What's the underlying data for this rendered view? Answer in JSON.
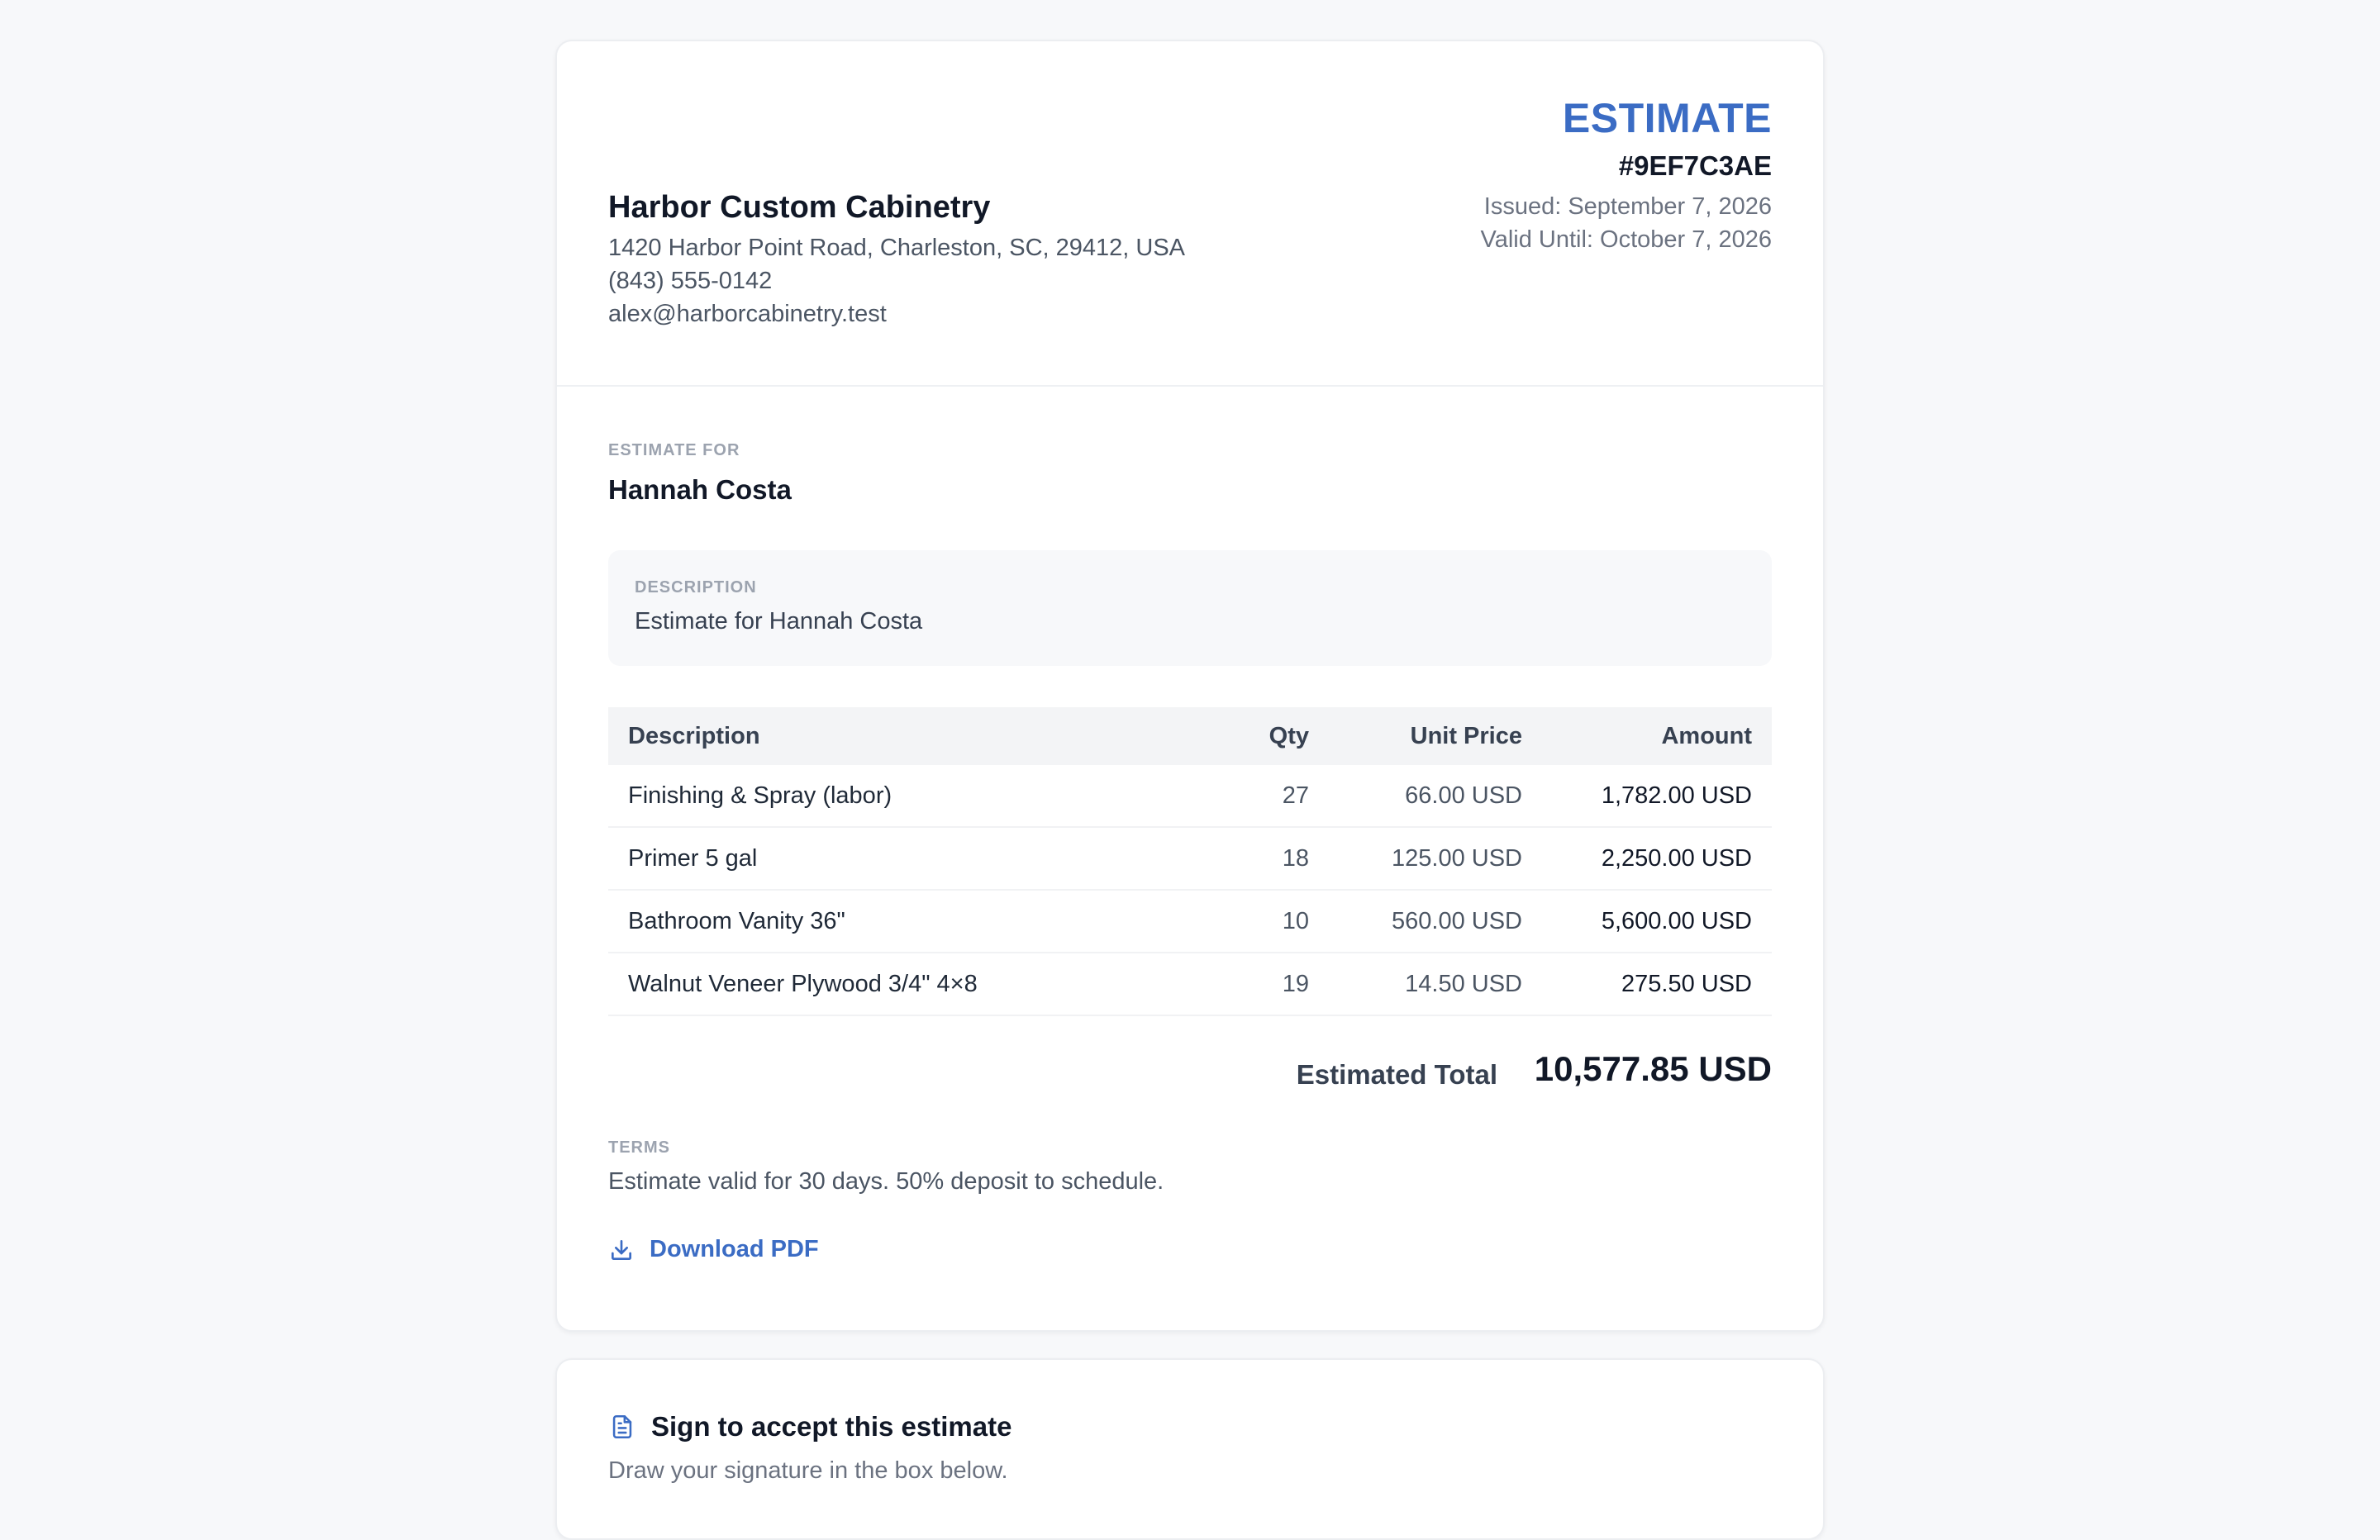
{
  "company": {
    "name": "Harbor Custom Cabinetry",
    "address": "1420 Harbor Point Road, Charleston, SC, 29412, USA",
    "phone": "(843) 555-0142",
    "email": "alex@harborcabinetry.test"
  },
  "estimate": {
    "title": "ESTIMATE",
    "number": "#9EF7C3AE",
    "issued": "Issued: September 7, 2026",
    "valid_until": "Valid Until: October 7, 2026"
  },
  "client": {
    "label": "ESTIMATE FOR",
    "name": "Hannah Costa"
  },
  "description": {
    "label": "DESCRIPTION",
    "text": "Estimate for Hannah Costa"
  },
  "table": {
    "headers": [
      "Description",
      "Qty",
      "Unit Price",
      "Amount"
    ],
    "rows": [
      [
        "Finishing & Spray (labor)",
        "27",
        "66.00 USD",
        "1,782.00 USD"
      ],
      [
        "Primer 5 gal",
        "18",
        "125.00 USD",
        "2,250.00 USD"
      ],
      [
        "Bathroom Vanity 36\"",
        "10",
        "560.00 USD",
        "5,600.00 USD"
      ],
      [
        "Walnut Veneer Plywood 3/4\" 4×8",
        "19",
        "14.50 USD",
        "275.50 USD"
      ]
    ]
  },
  "total": {
    "label": "Estimated Total",
    "value": "10,577.85 USD"
  },
  "terms": {
    "label": "TERMS",
    "text": "Estimate valid for 30 days. 50% deposit to schedule."
  },
  "download": {
    "label": "Download PDF",
    "icon": "download-icon"
  },
  "sign": {
    "title": "Sign to accept this estimate",
    "subtitle": "Draw your signature in the box below.",
    "icon": "document-icon"
  },
  "colors": {
    "accent": "#3b6cc4",
    "background": "#f7f8fa",
    "text": "#111827",
    "muted": "#6b7280"
  }
}
